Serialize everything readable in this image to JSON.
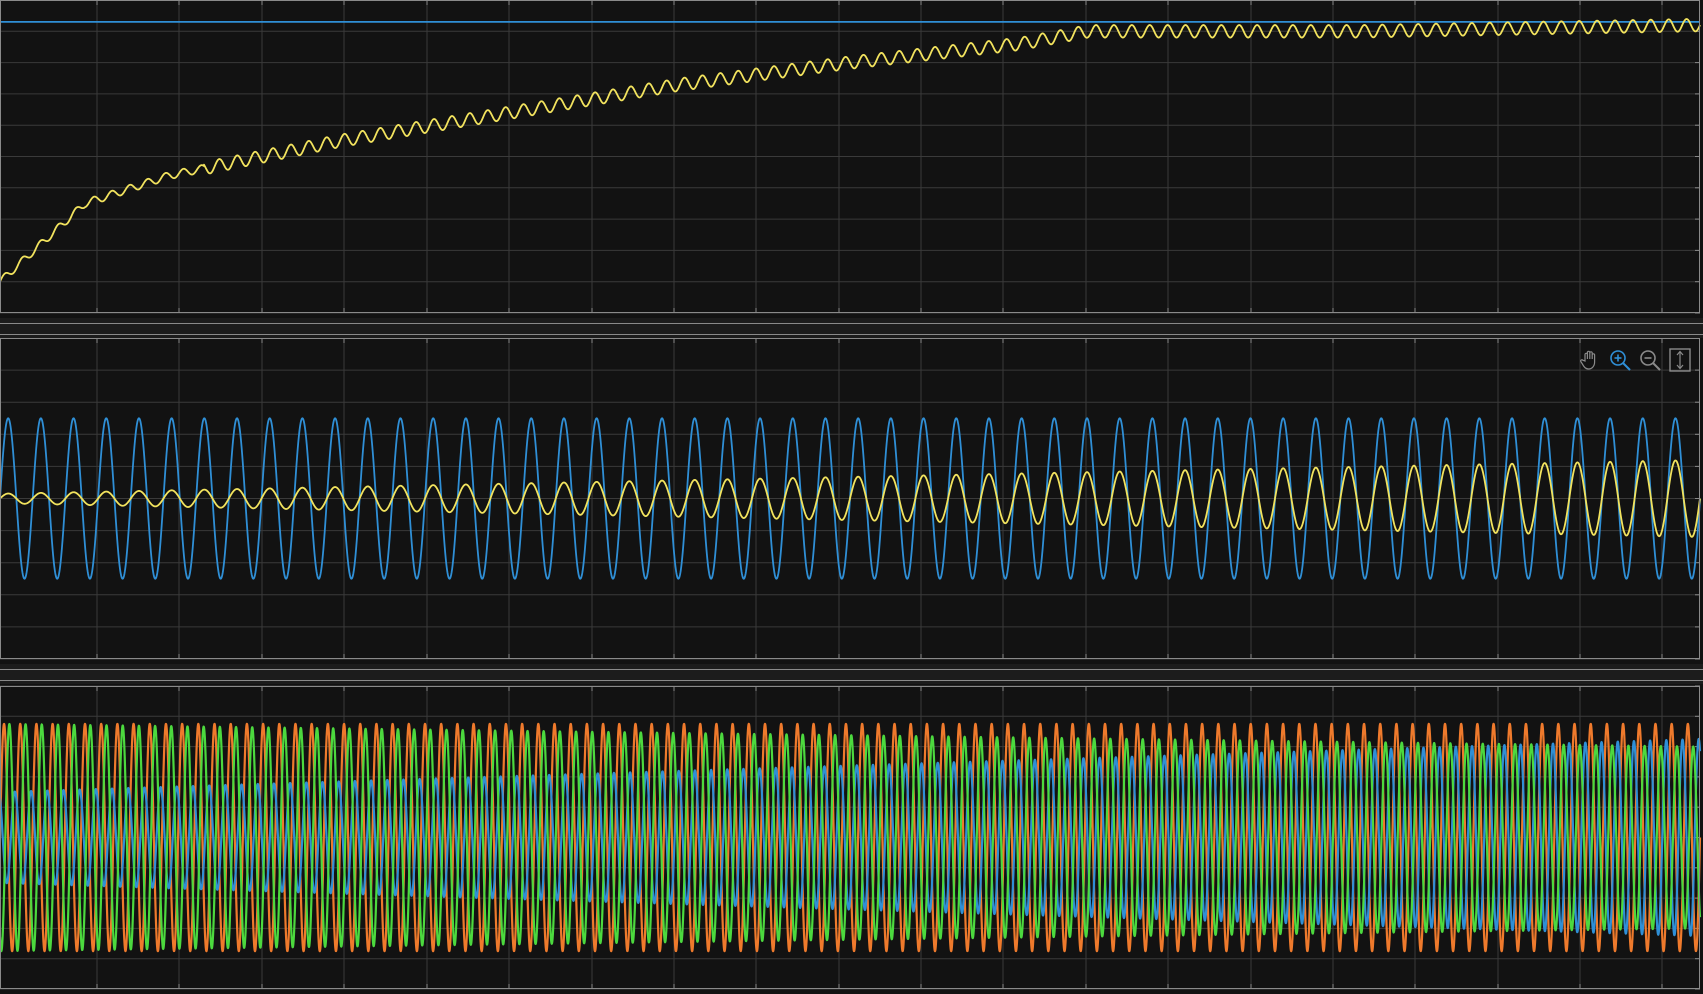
{
  "colors": {
    "background": "#121212",
    "grid": "#3a3a3a",
    "frame": "#8a8a8a",
    "yellow": "#f2e35e",
    "blue": "#2f8fd6",
    "orange": "#ef7a2c",
    "green": "#4cd93e"
  },
  "toolbar": {
    "pan": "hand-icon",
    "zoom_in": "zoom-in-icon",
    "zoom_out": "zoom-out-icon",
    "autoscale": "autoscale-icon"
  },
  "chart_data": [
    {
      "type": "line",
      "title": "",
      "xlabel": "",
      "ylabel": "",
      "xlim": [
        0,
        1
      ],
      "ylim": [
        0,
        1
      ],
      "grid": true,
      "series": [
        {
          "color": "#2f8fd6",
          "x": [
            0,
            1
          ],
          "y": [
            0.93,
            0.93
          ]
        },
        {
          "color": "#f2e35e",
          "x": [
            0,
            0.05,
            0.1,
            0.2,
            0.3,
            0.4,
            0.5,
            0.6,
            0.64,
            0.7,
            0.8,
            0.9,
            1.0
          ],
          "y": [
            0.1,
            0.35,
            0.44,
            0.55,
            0.64,
            0.73,
            0.8,
            0.86,
            0.9,
            0.9,
            0.9,
            0.91,
            0.92
          ],
          "ripple_amplitude": 0.02,
          "ripple_cycles": 95
        }
      ]
    },
    {
      "type": "line",
      "title": "",
      "xlabel": "",
      "ylabel": "",
      "xlim": [
        0,
        1
      ],
      "ylim": [
        -1,
        1
      ],
      "grid": true,
      "series": [
        {
          "color": "#2f8fd6",
          "shape": "sine",
          "cycles": 52,
          "amplitude": [
            0.5,
            0.5
          ],
          "offset": 0
        },
        {
          "color": "#f2e35e",
          "shape": "sine",
          "cycles": 52,
          "amplitude": [
            0.03,
            0.24
          ],
          "offset": 0
        }
      ]
    },
    {
      "type": "line",
      "title": "",
      "xlabel": "",
      "ylabel": "",
      "xlim": [
        0,
        1
      ],
      "ylim": [
        -1,
        1
      ],
      "grid": true,
      "series": [
        {
          "color": "#ef7a2c",
          "shape": "sine",
          "cycles": 105,
          "amplitude": [
            0.75,
            0.75
          ],
          "offset": 0
        },
        {
          "color": "#2f8fd6",
          "shape": "sine",
          "cycles": 105,
          "amplitude": [
            0.3,
            0.65
          ],
          "offset": 0.33
        },
        {
          "color": "#4cd93e",
          "shape": "sine",
          "cycles": 105,
          "amplitude": [
            0.75,
            0.6
          ],
          "offset": 0.67
        }
      ]
    }
  ]
}
